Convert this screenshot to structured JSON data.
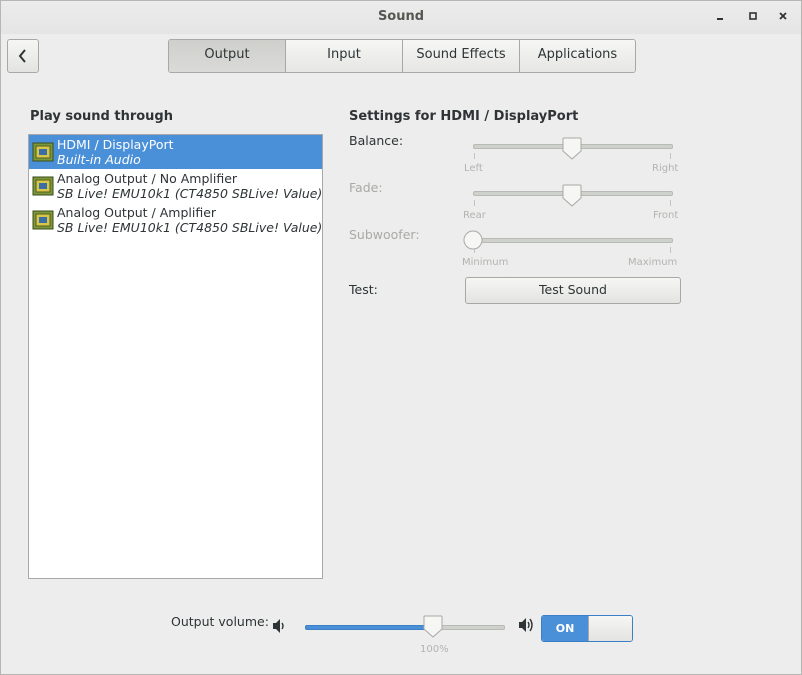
{
  "window": {
    "title": "Sound",
    "controls": {
      "minimize": "_",
      "maximize": "▫",
      "close": "×"
    }
  },
  "tabs": [
    {
      "label": "Output",
      "active": true
    },
    {
      "label": "Input",
      "active": false
    },
    {
      "label": "Sound Effects",
      "active": false
    },
    {
      "label": "Applications",
      "active": false
    }
  ],
  "output": {
    "list_title": "Play sound through",
    "devices": [
      {
        "name": "HDMI / DisplayPort",
        "detail": "Built-in Audio",
        "selected": true,
        "icon": "sound-card-icon"
      },
      {
        "name": "Analog Output / No Amplifier",
        "detail": "SB Live! EMU10k1 (CT4850 SBLive! Value)",
        "selected": false,
        "icon": "sound-card-icon"
      },
      {
        "name": "Analog Output / Amplifier",
        "detail": "SB Live! EMU10k1 (CT4850 SBLive! Value)",
        "selected": false,
        "icon": "sound-card-icon"
      }
    ]
  },
  "settings": {
    "title": "Settings for HDMI / DisplayPort",
    "balance": {
      "label": "Balance:",
      "left": "Left",
      "right": "Right",
      "value": 0.5,
      "enabled": true
    },
    "fade": {
      "label": "Fade:",
      "left": "Rear",
      "right": "Front",
      "value": 0.5,
      "enabled": false
    },
    "subwoofer": {
      "label": "Subwoofer:",
      "left": "Minimum",
      "right": "Maximum",
      "value": 0.0,
      "enabled": false
    },
    "test": {
      "label": "Test:",
      "button": "Test Sound"
    }
  },
  "volume": {
    "label": "Output volume:",
    "value_percent": 100,
    "value_label": "100%",
    "mute_switch": "ON",
    "low_icon": "speaker-low-icon",
    "high_icon": "speaker-high-icon"
  },
  "colors": {
    "accent": "#4a90d9",
    "background": "#ededed"
  }
}
